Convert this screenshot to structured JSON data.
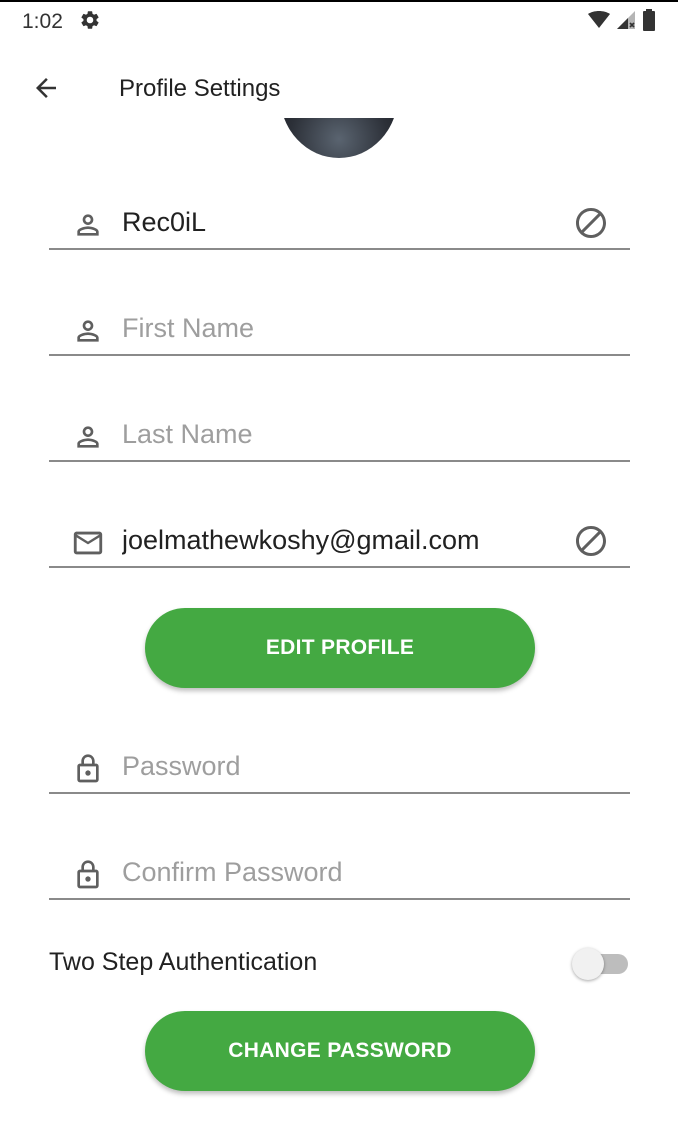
{
  "status_bar": {
    "time": "1:02"
  },
  "app_bar": {
    "title": "Profile Settings"
  },
  "profile_form": {
    "username": {
      "value": "Rec0iL",
      "placeholder": ""
    },
    "first_name": {
      "value": "",
      "placeholder": "First Name"
    },
    "last_name": {
      "value": "",
      "placeholder": "Last Name"
    },
    "email": {
      "value": "joelmathewkoshy@gmail.com",
      "placeholder": ""
    },
    "edit_button_label": "EDIT PROFILE"
  },
  "password_form": {
    "password": {
      "value": "",
      "placeholder": "Password"
    },
    "confirm_password": {
      "value": "",
      "placeholder": "Confirm Password"
    },
    "two_step_label": "Two Step Authentication",
    "two_step_enabled": false,
    "change_button_label": "CHANGE PASSWORD"
  },
  "colors": {
    "accent_green": "#44a942",
    "underline": "#8a8a8a",
    "icon_gray": "#5f5f5f"
  }
}
